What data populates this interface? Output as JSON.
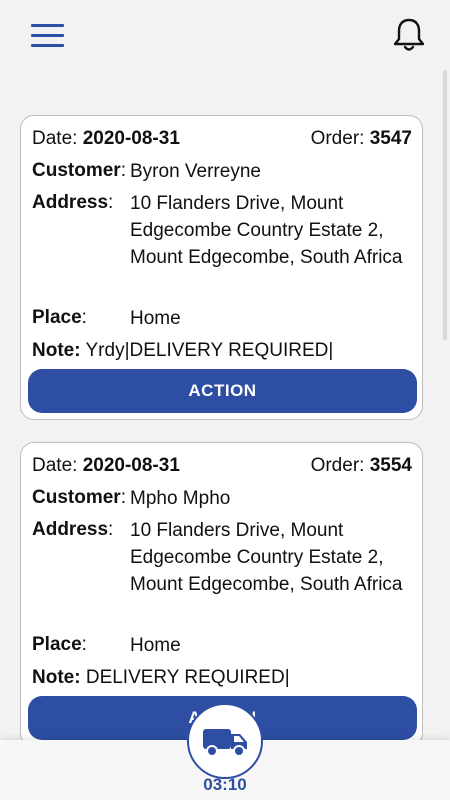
{
  "header": {
    "menu_icon": "hamburger-menu-icon",
    "bell_icon": "bell-icon"
  },
  "labels": {
    "date": "Date:",
    "order": "Order:",
    "customer": "Customer",
    "address": "Address",
    "place": "Place",
    "note": "Note:",
    "colon": ":"
  },
  "orders": [
    {
      "date": "2020-08-31",
      "order_number": "3547",
      "customer": "Byron Verreyne",
      "address": "10 Flanders Drive, Mount Edgecombe Country Estate 2, Mount Edgecombe, South Africa",
      "place": "Home",
      "note": "Yrdy|DELIVERY REQUIRED|",
      "action_label": "ACTION"
    },
    {
      "date": "2020-08-31",
      "order_number": "3554",
      "customer": "Mpho Mpho",
      "address": "10 Flanders Drive, Mount Edgecombe Country Estate 2, Mount Edgecombe, South Africa",
      "place": "Home",
      "note": "DELIVERY REQUIRED|",
      "action_label": "ACTION"
    }
  ],
  "bottom": {
    "truck_icon": "delivery-truck-icon",
    "timer": "03:10"
  },
  "colors": {
    "accent": "#2d4ea3",
    "background": "#f2f2f2",
    "card": "#ffffff"
  }
}
